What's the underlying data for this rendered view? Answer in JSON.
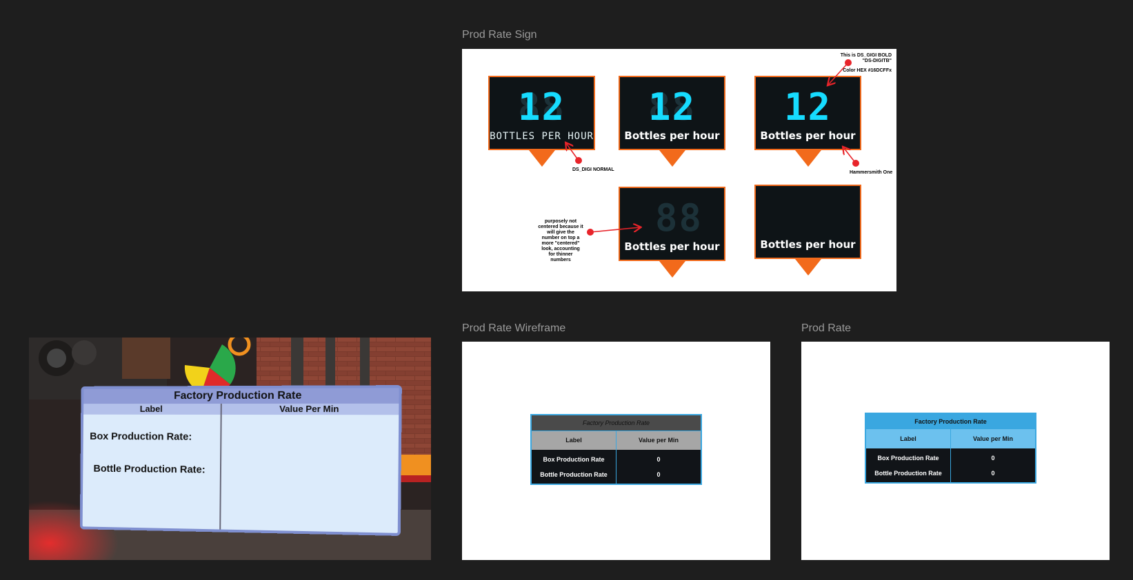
{
  "frames": {
    "sign": {
      "title": "Prod Rate Sign"
    },
    "wireframe": {
      "title": "Prod Rate Wireframe"
    },
    "prodrate": {
      "title": "Prod Rate"
    }
  },
  "signs": {
    "s1": {
      "ghost": "88",
      "digits": "12",
      "caption": "BOTTLES PER HOUR"
    },
    "s2": {
      "ghost": "88",
      "digits": "12",
      "caption": "Bottles per hour"
    },
    "s3": {
      "digits": "12",
      "caption": "Bottles per hour"
    },
    "s4": {
      "ghost": "88",
      "caption": "Bottles per hour"
    },
    "s5": {
      "caption": "Bottles per hour"
    }
  },
  "notes": {
    "digi_bold": "This is DS_GIGI BOLD\n\"DS-DIGITB\"",
    "color_hex": "Color HEX #16DCFFx",
    "digi_normal": "DS_DIGI NORMAL",
    "font_hammersmith": "Hammersmith One",
    "not_centered": "purposely not centered because it will give the number on top a more \"centered\" look, accounting for thinner numbers"
  },
  "table": {
    "title": "Factory Production Rate",
    "col_label": "Label",
    "col_value": "Value per Min",
    "rows": [
      {
        "label": "Box Production Rate",
        "value": "0"
      },
      {
        "label": "Bottle Production Rate",
        "value": "0"
      }
    ]
  },
  "game_panel": {
    "title": "Factory Production Rate",
    "col_label": "Label",
    "col_value": "Value Per Min",
    "row1": "Box Production Rate:",
    "row2": "Bottle Production Rate:"
  },
  "colors": {
    "background": "#1e1e1e",
    "sign_orange": "#f26a1b",
    "digit_cyan": "#16dcff",
    "table_blue": "#3aa7e0",
    "table_light_blue": "#6cc1ee",
    "table_dark": "#111418"
  }
}
